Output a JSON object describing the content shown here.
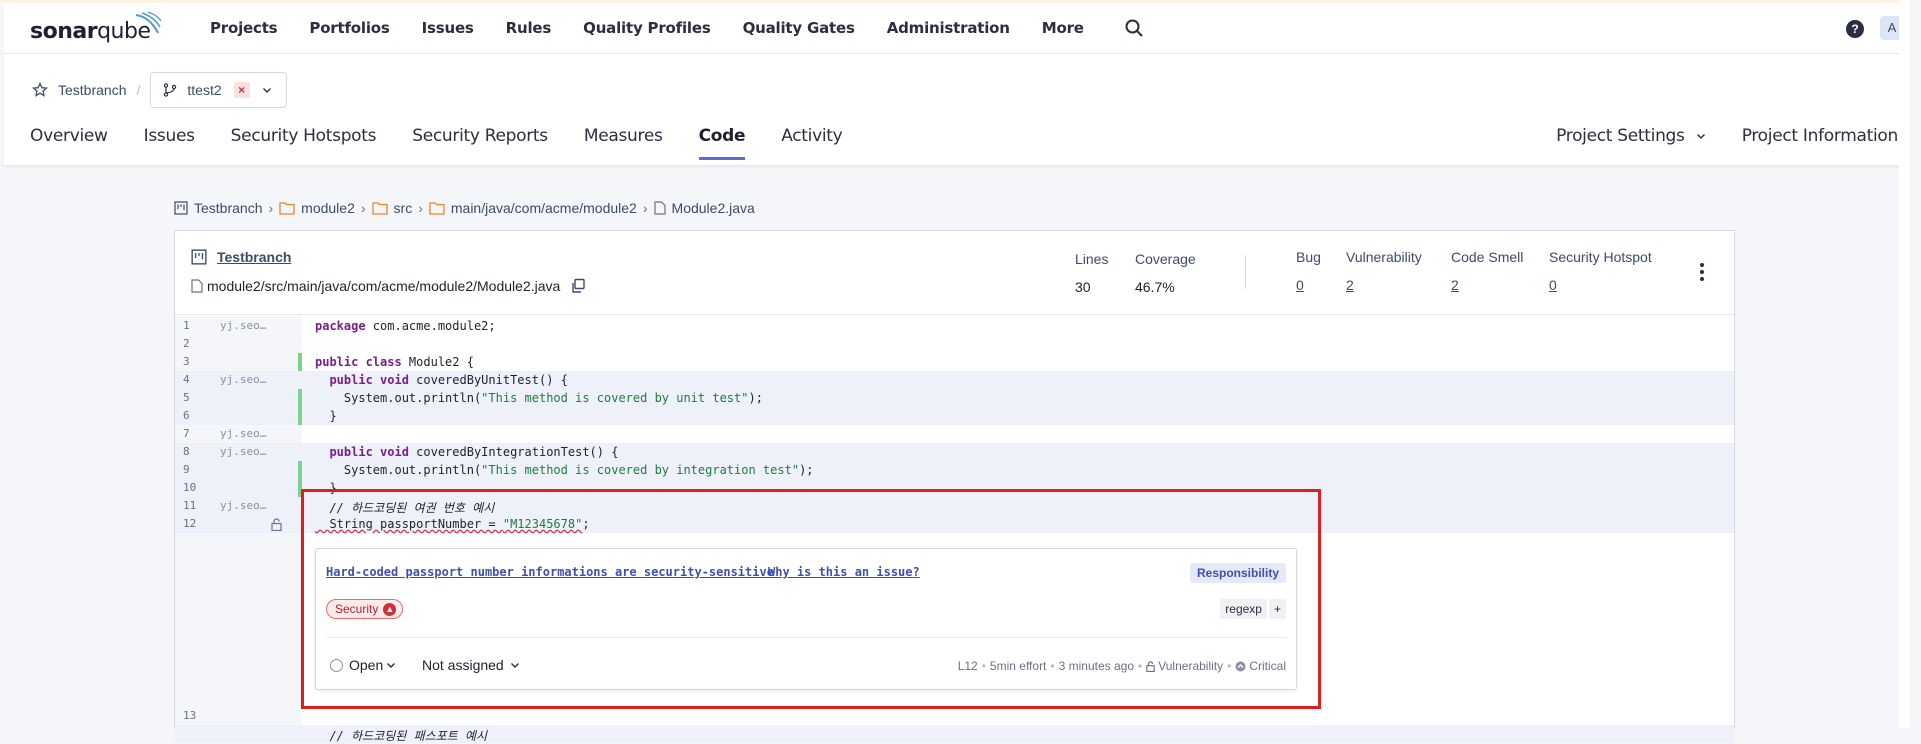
{
  "topnav": {
    "logo_text_bold": "sonar",
    "logo_text_thin": "qube",
    "links": [
      "Projects",
      "Portfolios",
      "Issues",
      "Rules",
      "Quality Profiles",
      "Quality Gates",
      "Administration",
      "More"
    ],
    "help_label": "?",
    "avatar_initial": "A"
  },
  "project": {
    "name": "Testbranch",
    "separator": "/",
    "branch": "ttest2",
    "branch_badge": "×"
  },
  "tabs": {
    "left": [
      "Overview",
      "Issues",
      "Security Hotspots",
      "Security Reports",
      "Measures",
      "Code",
      "Activity"
    ],
    "active": "Code",
    "right": [
      "Project Settings",
      "Project Information"
    ]
  },
  "breadcrumb": {
    "project": "Testbranch",
    "items": [
      "module2",
      "src",
      "main/java/com/acme/module2"
    ],
    "file": "Module2.java"
  },
  "panel": {
    "project_link": "Testbranch",
    "file_path": "module2/src/main/java/com/acme/module2/Module2.java",
    "lines_label": "Lines",
    "lines_value": "30",
    "coverage_label": "Coverage",
    "coverage_value": "46.7%",
    "bug_label": "Bug",
    "bug_value": "0",
    "vuln_label": "Vulnerability",
    "vuln_value": "2",
    "smell_label": "Code Smell",
    "smell_value": "2",
    "hotspot_label": "Security Hotspot",
    "hotspot_value": "0"
  },
  "code_lines": [
    {
      "n": "1",
      "blame": "yj.seo…"
    },
    {
      "n": "2",
      "blame": ""
    },
    {
      "n": "3",
      "blame": ""
    },
    {
      "n": "4",
      "blame": "yj.seo…"
    },
    {
      "n": "5",
      "blame": ""
    },
    {
      "n": "6",
      "blame": ""
    },
    {
      "n": "7",
      "blame": "yj.seo…"
    },
    {
      "n": "8",
      "blame": "yj.seo…"
    },
    {
      "n": "9",
      "blame": ""
    },
    {
      "n": "10",
      "blame": ""
    },
    {
      "n": "11",
      "blame": "yj.seo…"
    },
    {
      "n": "12",
      "blame": ""
    },
    {
      "n": "13",
      "blame": ""
    }
  ],
  "code_text": {
    "l1_kw": "package",
    "l1_rest": " com.acme.module2;",
    "l3_kw": "public class",
    "l3_rest": " Module2 {",
    "l4_kw": "  public void",
    "l4_rest": " coveredByUnitTest() {",
    "l5_pre": "    System.out.println(",
    "l5_str": "\"This method is covered by unit test\"",
    "l5_post": ");",
    "l6": "  }",
    "l8_kw": "  public void",
    "l8_rest": " coveredByIntegrationTest() {",
    "l9_pre": "    System.out.println(",
    "l9_str": "\"This method is covered by integration test\"",
    "l9_post": ");",
    "l10": "  }",
    "l11": "  // 하드코딩된 여권 번호 예시",
    "l12_pre": "  String passportNumber = ",
    "l12_str": "\"M12345678\"",
    "l12_post": ";",
    "l14": "  // 하드코딩된 패스포트 예시"
  },
  "issue": {
    "title": "Hard-coded passport number informations are security-sensitive",
    "why": "Why is this an issue?",
    "responsibility": "Responsibility",
    "quality": "Security",
    "tag": "regexp",
    "tag_add": "+",
    "status": "Open",
    "assignee": "Not assigned",
    "line_ref": "L12",
    "effort": "5min effort",
    "age": "3 minutes ago",
    "type": "Vulnerability",
    "severity": "Critical"
  },
  "colors": {
    "accent": "#5d6cd0",
    "coverage_green": "#7ad48e",
    "highlight_box": "#e01e1e",
    "link": "#3f4fb0"
  }
}
